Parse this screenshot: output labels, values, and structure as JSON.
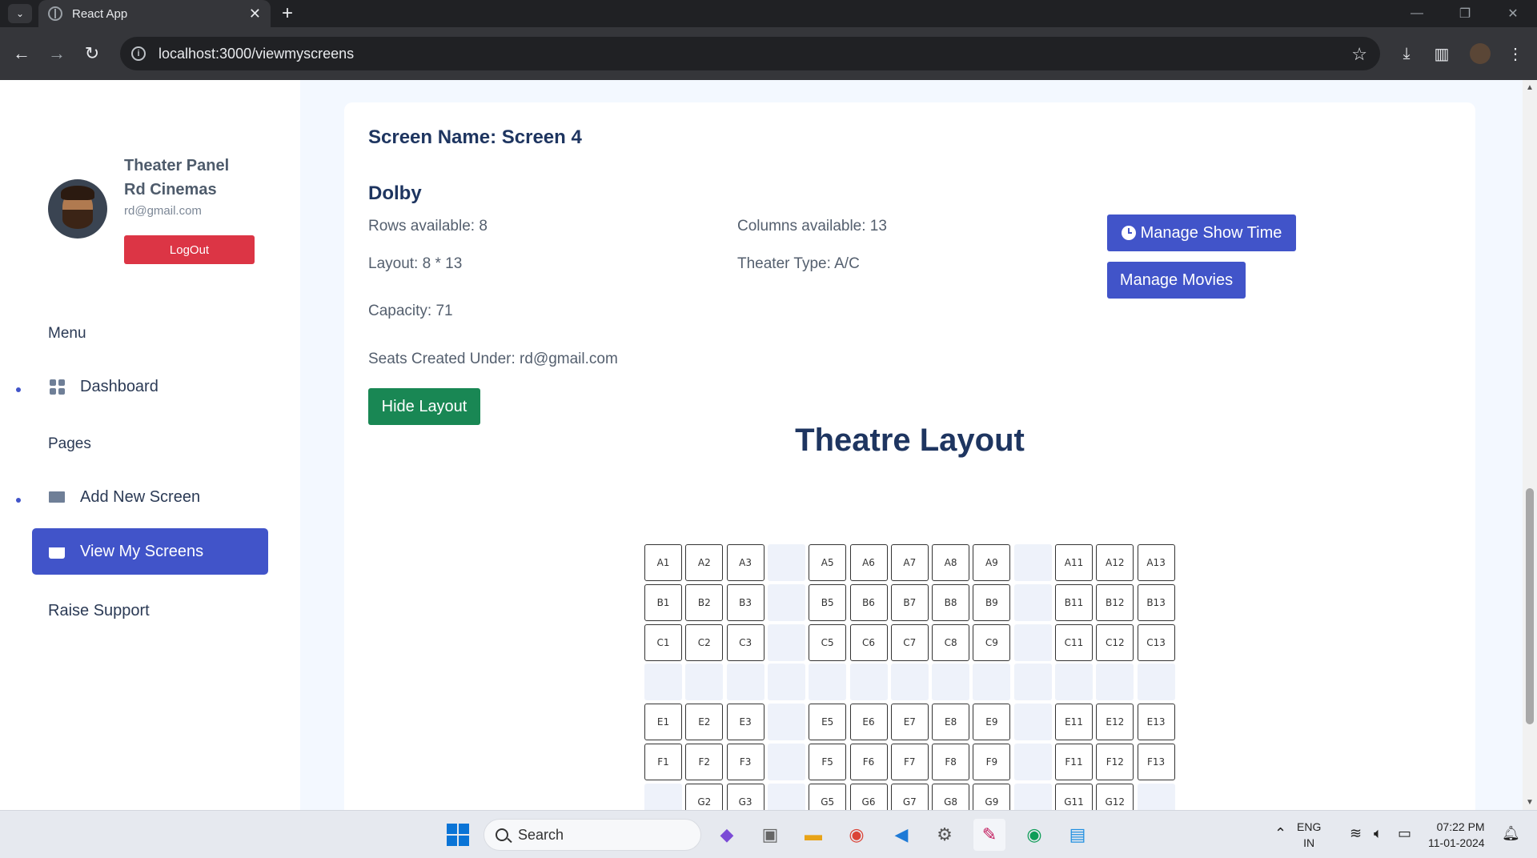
{
  "browser": {
    "tab_title": "React App",
    "url": "localhost:3000/viewmyscreens"
  },
  "sidebar": {
    "panel_title": "Theater Panel",
    "theater_name": "Rd Cinemas",
    "email": "rd@gmail.com",
    "logout_label": "LogOut",
    "menu_heading": "Menu",
    "pages_heading": "Pages",
    "items": [
      {
        "label": "Dashboard",
        "icon": "grid-icon"
      },
      {
        "label": "Add New Screen",
        "icon": "envelope-icon"
      },
      {
        "label": "View My Screens",
        "icon": "basket-icon",
        "active": true
      },
      {
        "label": "Raise Support"
      }
    ]
  },
  "screen": {
    "name": "Screen Name: Screen 4",
    "type": "Dolby",
    "rows": "Rows available: 8",
    "columns": "Columns available: 13",
    "layout": "Layout: 8 * 13",
    "theater_type": "Theater Type: A/C",
    "capacity": "Capacity: 71",
    "created_under": "Seats Created Under: rd@gmail.com",
    "manage_show_time_label": "Manage Show Time",
    "manage_movies_label": "Manage Movies",
    "hide_layout_label": "Hide Layout",
    "layout_title": "Theatre Layout"
  },
  "seat_rows": [
    [
      "A1",
      "A2",
      "A3",
      "",
      "A5",
      "A6",
      "A7",
      "A8",
      "A9",
      "",
      "A11",
      "A12",
      "A13"
    ],
    [
      "B1",
      "B2",
      "B3",
      "",
      "B5",
      "B6",
      "B7",
      "B8",
      "B9",
      "",
      "B11",
      "B12",
      "B13"
    ],
    [
      "C1",
      "C2",
      "C3",
      "",
      "C5",
      "C6",
      "C7",
      "C8",
      "C9",
      "",
      "C11",
      "C12",
      "C13"
    ],
    [
      "",
      "",
      "",
      "",
      "",
      "",
      "",
      "",
      "",
      "",
      "",
      "",
      ""
    ],
    [
      "E1",
      "E2",
      "E3",
      "",
      "E5",
      "E6",
      "E7",
      "E8",
      "E9",
      "",
      "E11",
      "E12",
      "E13"
    ],
    [
      "F1",
      "F2",
      "F3",
      "",
      "F5",
      "F6",
      "F7",
      "F8",
      "F9",
      "",
      "F11",
      "F12",
      "F13"
    ],
    [
      "",
      "G2",
      "G3",
      "",
      "G5",
      "G6",
      "G7",
      "G8",
      "G9",
      "",
      "G11",
      "G12",
      ""
    ]
  ],
  "taskbar": {
    "search_placeholder": "Search",
    "lang_line1": "ENG",
    "lang_line2": "IN",
    "time": "07:22 PM",
    "date": "11-01-2024"
  }
}
